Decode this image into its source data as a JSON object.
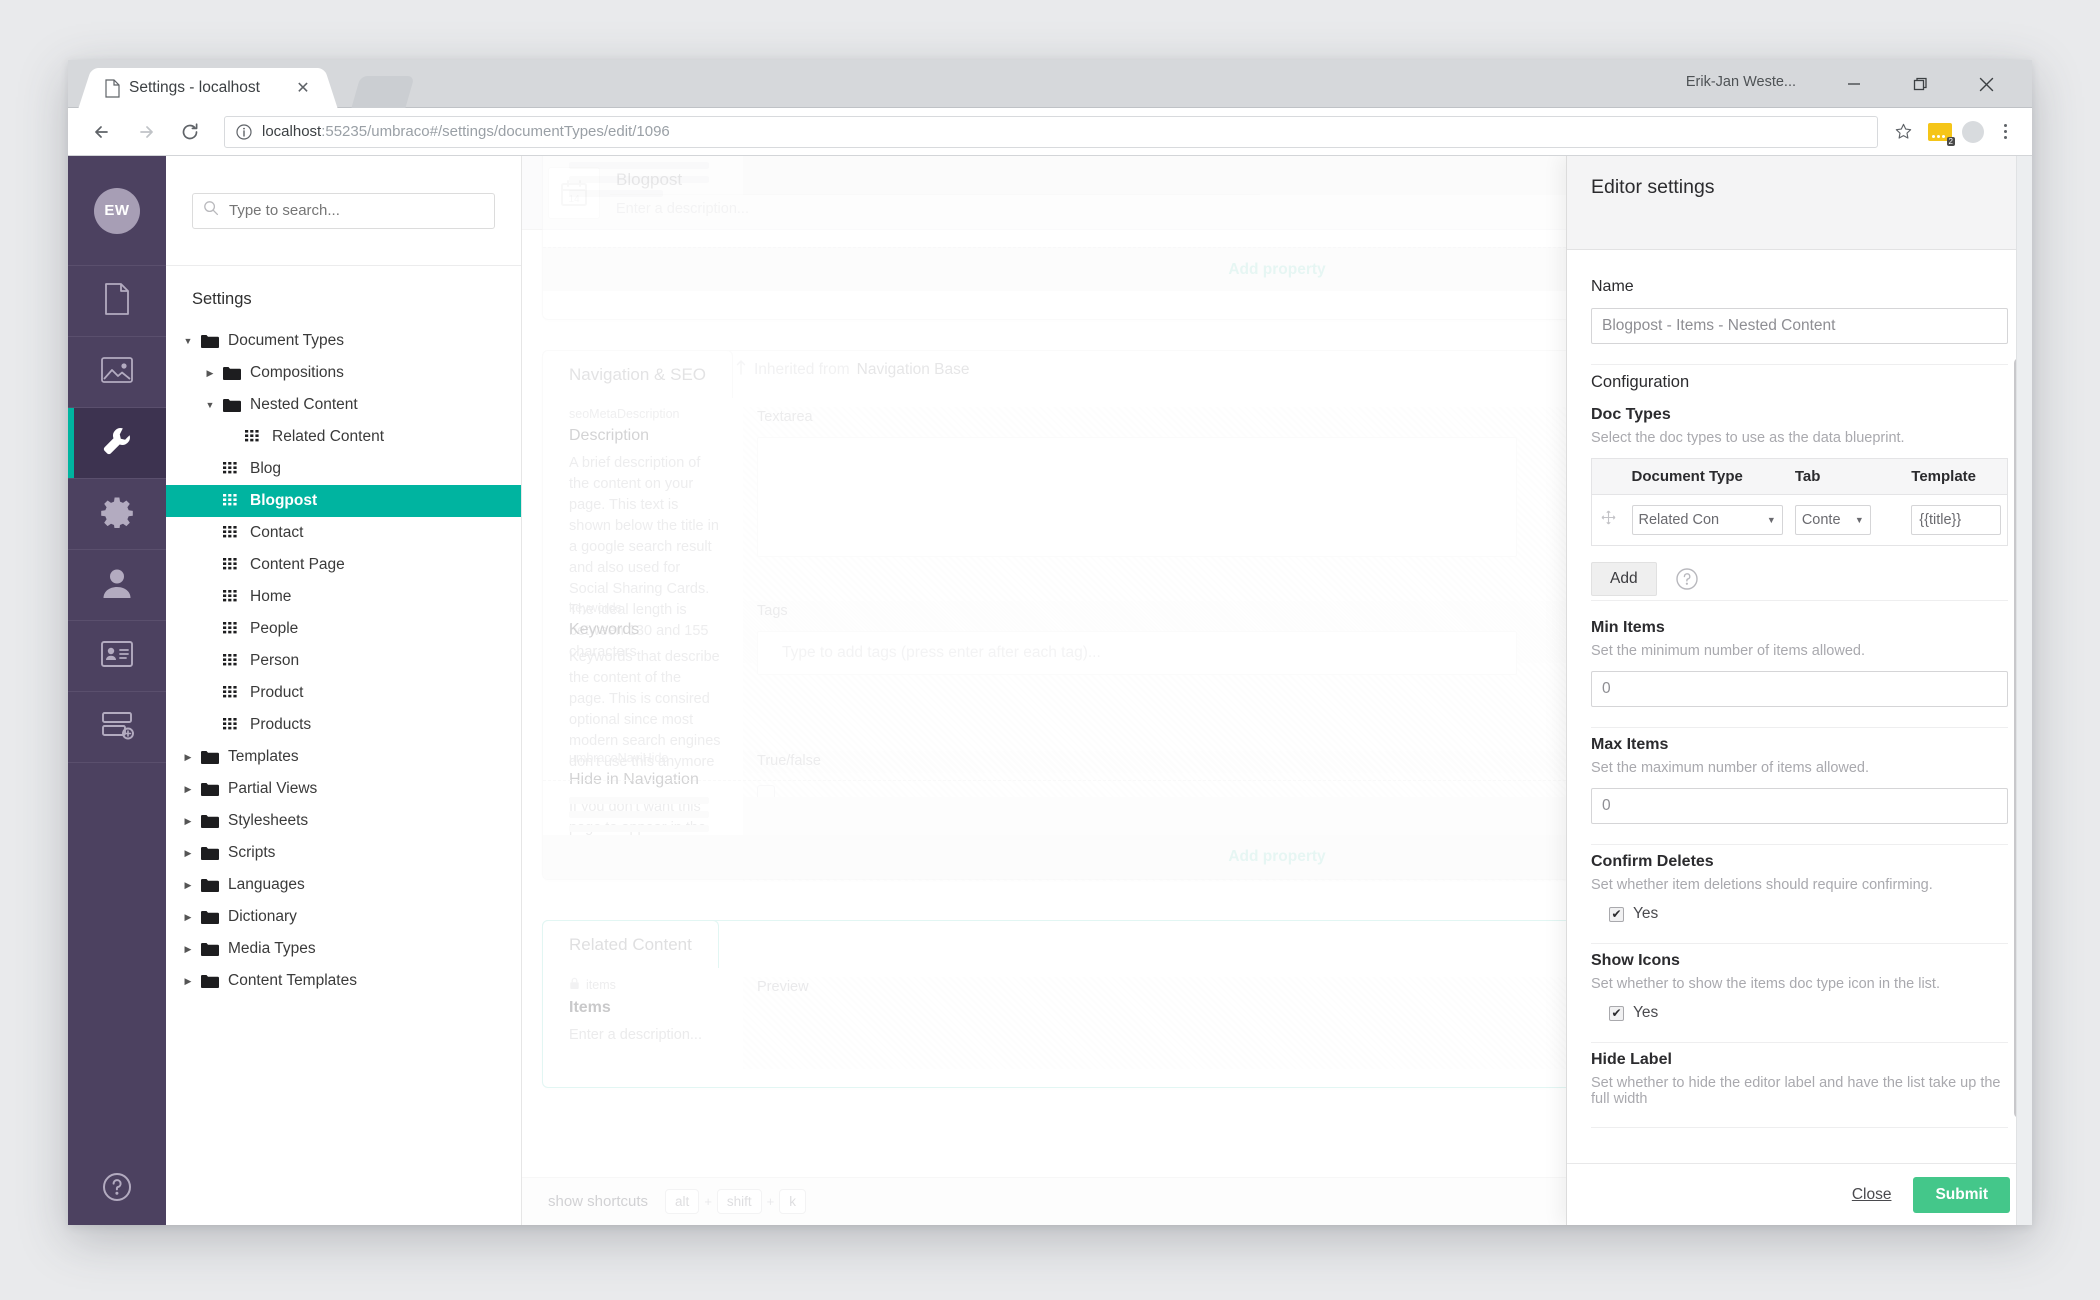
{
  "browser": {
    "tab_title": "Settings - localhost",
    "profile_name": "Erik-Jan Weste...",
    "url_host": "localhost",
    "url_rest": ":55235/umbraco#/settings/documentTypes/edit/1096",
    "ext_badge": "2"
  },
  "rail": {
    "avatar_initials": "EW",
    "items": [
      {
        "name": "content",
        "icon": "document-icon"
      },
      {
        "name": "media",
        "icon": "image-icon"
      },
      {
        "name": "settings",
        "icon": "wrench-icon",
        "active": true
      },
      {
        "name": "developer",
        "icon": "gear-icon"
      },
      {
        "name": "users",
        "icon": "user-icon"
      },
      {
        "name": "members",
        "icon": "id-card-icon"
      },
      {
        "name": "forms",
        "icon": "server-add-icon"
      }
    ],
    "help_icon": "question-circle-icon"
  },
  "search": {
    "placeholder": "Type to search...",
    "value": ""
  },
  "tree": {
    "title": "Settings",
    "nodes": [
      {
        "label": "Document Types",
        "depth": 0,
        "caret": "down",
        "icon": "folder-icon"
      },
      {
        "label": "Compositions",
        "depth": 1,
        "caret": "right",
        "icon": "folder-icon"
      },
      {
        "label": "Nested Content",
        "depth": 1,
        "caret": "down",
        "icon": "folder-icon"
      },
      {
        "label": "Related Content",
        "depth": 2,
        "caret": "none",
        "icon": "doctype-icon"
      },
      {
        "label": "Blog",
        "depth": 1,
        "caret": "none",
        "icon": "doctype-icon"
      },
      {
        "label": "Blogpost",
        "depth": 1,
        "caret": "none",
        "icon": "doctype-icon",
        "selected": true
      },
      {
        "label": "Contact",
        "depth": 1,
        "caret": "none",
        "icon": "doctype-icon"
      },
      {
        "label": "Content Page",
        "depth": 1,
        "caret": "none",
        "icon": "doctype-icon"
      },
      {
        "label": "Home",
        "depth": 1,
        "caret": "none",
        "icon": "doctype-icon"
      },
      {
        "label": "People",
        "depth": 1,
        "caret": "none",
        "icon": "doctype-icon"
      },
      {
        "label": "Person",
        "depth": 1,
        "caret": "none",
        "icon": "doctype-icon"
      },
      {
        "label": "Product",
        "depth": 1,
        "caret": "none",
        "icon": "doctype-icon"
      },
      {
        "label": "Products",
        "depth": 1,
        "caret": "none",
        "icon": "doctype-icon"
      },
      {
        "label": "Templates",
        "depth": 0,
        "caret": "right",
        "icon": "folder-icon"
      },
      {
        "label": "Partial Views",
        "depth": 0,
        "caret": "right",
        "icon": "folder-icon"
      },
      {
        "label": "Stylesheets",
        "depth": 0,
        "caret": "right",
        "icon": "folder-icon"
      },
      {
        "label": "Scripts",
        "depth": 0,
        "caret": "right",
        "icon": "folder-icon"
      },
      {
        "label": "Languages",
        "depth": 0,
        "caret": "right",
        "icon": "folder-icon"
      },
      {
        "label": "Dictionary",
        "depth": 0,
        "caret": "right",
        "icon": "folder-icon"
      },
      {
        "label": "Media Types",
        "depth": 0,
        "caret": "right",
        "icon": "folder-icon"
      },
      {
        "label": "Content Templates",
        "depth": 0,
        "caret": "right",
        "icon": "folder-icon"
      }
    ]
  },
  "doc": {
    "name": "Blogpost",
    "description_placeholder": "Enter a description...",
    "alias": "blogp",
    "icon": "calendar-14-icon",
    "lock_icon": "lock-icon"
  },
  "groups": {
    "add_property": "Add property",
    "nav_seo": {
      "tab_label": "Navigation & SEO",
      "inherited_prefix": "Inherited from",
      "inherited_from": "Navigation Base",
      "properties": [
        {
          "alias": "seoMetaDescription",
          "name": "Description",
          "description": "A brief description of the content on your page. This text is shown below the title in a google search result and also used for Social Sharing Cards. The ideal length is between 130 and 155 characters",
          "editor": "Textarea",
          "value": ""
        },
        {
          "alias": "keywords",
          "name": "Keywords",
          "description": "Keywords that describe the content of the page. This is consired optional since most modern search engines don't use this anymore",
          "editor": "Tags",
          "placeholder": "Type to add tags (press enter after each tag)..."
        },
        {
          "alias": "umbracoNaviHide",
          "name": "Hide in Navigation",
          "description": "If you don't want this page to appear in the navigation, check this box",
          "editor": "True/false",
          "checked": false
        }
      ]
    },
    "related_content": {
      "tab_label": "Related Content",
      "properties": [
        {
          "alias": "items",
          "name": "Items",
          "description_placeholder": "Enter a description...",
          "editor": "Preview"
        }
      ]
    }
  },
  "footer": {
    "shortcut_label": "show shortcuts",
    "keys": [
      "alt",
      "shift",
      "k"
    ],
    "plus": "+"
  },
  "editor": {
    "title": "Editor settings",
    "name_label": "Name",
    "name_value": "Blogpost - Items - Nested Content",
    "configuration_label": "Configuration",
    "doc_types": {
      "label": "Doc Types",
      "description": "Select the doc types to use as the data blueprint.",
      "columns": [
        "Document Type",
        "Tab",
        "Template"
      ],
      "rows": [
        {
          "handle": "drag-handle-icon",
          "document_type": "Related Con",
          "tab": "Conte",
          "template": "{{title}}"
        }
      ],
      "add_label": "Add",
      "help_icon": "question-circle-icon"
    },
    "min_items": {
      "label": "Min Items",
      "description": "Set the minimum number of items allowed.",
      "value": "0"
    },
    "max_items": {
      "label": "Max Items",
      "description": "Set the maximum number of items allowed.",
      "value": "0"
    },
    "confirm_deletes": {
      "label": "Confirm Deletes",
      "description": "Set whether item deletions should require confirming.",
      "checkbox_label": "Yes",
      "checked": true
    },
    "show_icons": {
      "label": "Show Icons",
      "description": "Set whether to show the items doc type icon in the list.",
      "checkbox_label": "Yes",
      "checked": true
    },
    "hide_label": {
      "label": "Hide Label",
      "description": "Set whether to hide the editor label and have the list take up the full width"
    },
    "close_label": "Close",
    "submit_label": "Submit"
  },
  "colors": {
    "umbraco_teal": "#00b4a0",
    "rail_purple": "#4c4160",
    "submit_green": "#44c78a",
    "tab_teal_border": "#97ded4"
  }
}
